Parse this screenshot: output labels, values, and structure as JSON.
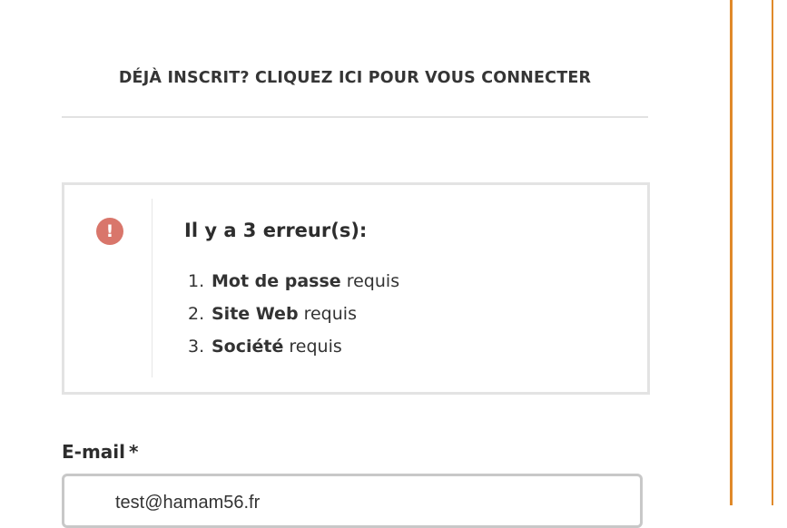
{
  "login_prompt": "DÉJÀ INSCRIT? CLIQUEZ ICI POUR VOUS CONNECTER",
  "errors": {
    "title": "Il y a 3 erreur(s):",
    "icon": "error-icon",
    "items": [
      {
        "num": "1.",
        "field": "Mot de passe",
        "suffix": " requis"
      },
      {
        "num": "2.",
        "field": "Site Web",
        "suffix": " requis"
      },
      {
        "num": "3.",
        "field": "Société",
        "suffix": " requis"
      }
    ]
  },
  "email": {
    "label": "E-mail",
    "required_mark": "*",
    "value": "test@hamam56.fr"
  },
  "colors": {
    "accent_border": "#e08a2a",
    "error_icon": "#d9766b"
  }
}
